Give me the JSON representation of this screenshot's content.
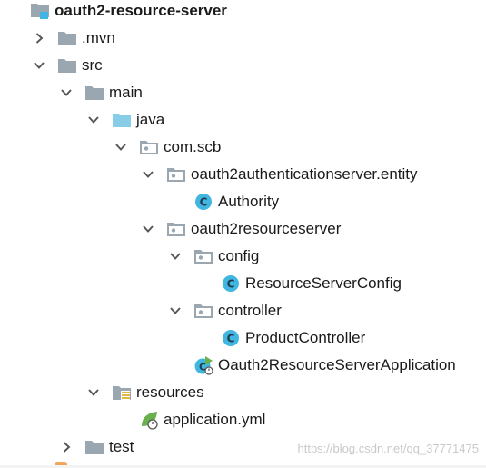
{
  "tree": {
    "items": [
      {
        "label": "oauth2-resource-server",
        "icon": "module-folder-icon",
        "arrow": "none",
        "depth": 0
      },
      {
        "label": ".mvn",
        "icon": "folder-icon",
        "arrow": "collapsed",
        "depth": 1
      },
      {
        "label": "src",
        "icon": "folder-icon",
        "arrow": "expanded",
        "depth": 1
      },
      {
        "label": "main",
        "icon": "folder-icon",
        "arrow": "expanded",
        "depth": 2
      },
      {
        "label": "java",
        "icon": "source-folder-icon",
        "arrow": "expanded",
        "depth": 3
      },
      {
        "label": "com.scb",
        "icon": "package-icon",
        "arrow": "expanded",
        "depth": 4
      },
      {
        "label": "oauth2authenticationserver.entity",
        "icon": "package-icon",
        "arrow": "expanded",
        "depth": 5
      },
      {
        "label": "Authority",
        "icon": "class-icon",
        "arrow": "none",
        "depth": 6
      },
      {
        "label": "oauth2resourceserver",
        "icon": "package-icon",
        "arrow": "expanded",
        "depth": 5
      },
      {
        "label": "config",
        "icon": "package-icon",
        "arrow": "expanded",
        "depth": 6
      },
      {
        "label": "ResourceServerConfig",
        "icon": "class-icon",
        "arrow": "none",
        "depth": 7
      },
      {
        "label": "controller",
        "icon": "package-icon",
        "arrow": "expanded",
        "depth": 6
      },
      {
        "label": "ProductController",
        "icon": "class-icon",
        "arrow": "none",
        "depth": 7
      },
      {
        "label": "Oauth2ResourceServerApplication",
        "icon": "spring-boot-class-icon",
        "arrow": "none",
        "depth": 6
      },
      {
        "label": "resources",
        "icon": "resources-folder-icon",
        "arrow": "expanded",
        "depth": 3
      },
      {
        "label": "application.yml",
        "icon": "spring-config-file-icon",
        "arrow": "none",
        "depth": 4
      },
      {
        "label": "test",
        "icon": "folder-icon",
        "arrow": "collapsed",
        "depth": 2
      }
    ]
  },
  "watermark": "https://blog.csdn.net/qq_37771475",
  "colors": {
    "folder": "#9aa7b0",
    "source_folder": "#87cde8",
    "class_badge": "#40b6e0",
    "spring_green": "#6ab04c",
    "arrow": "#555555"
  }
}
